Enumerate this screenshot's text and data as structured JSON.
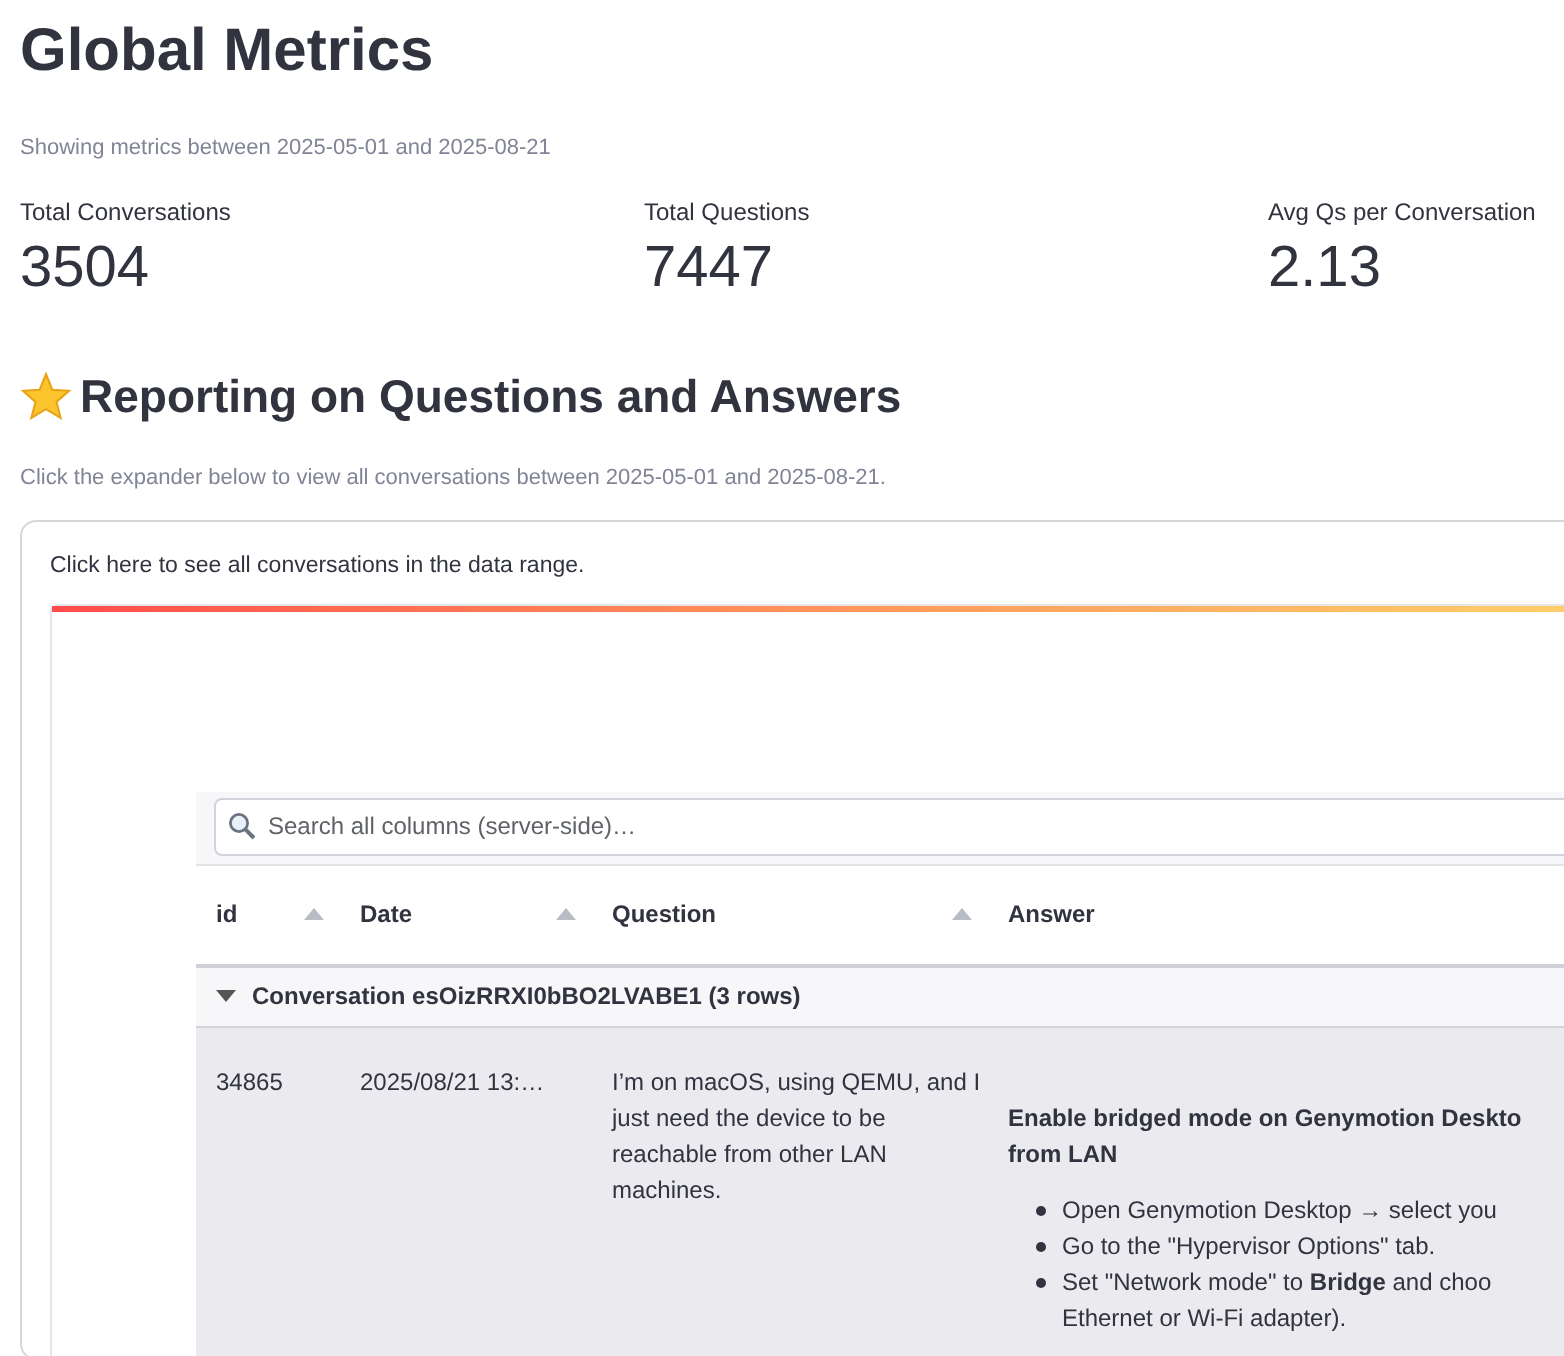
{
  "title": "Global Metrics",
  "caption": "Showing metrics between 2025-05-01 and 2025-08-21",
  "metrics": [
    {
      "label": "Total Conversations",
      "value": "3504"
    },
    {
      "label": "Total Questions",
      "value": "7447"
    },
    {
      "label": "Avg Qs per Conversation",
      "value": "2.13"
    }
  ],
  "section": {
    "title": "Reporting on Questions and Answers",
    "caption": "Click the expander below to view all conversations between 2025-05-01 and 2025-08-21."
  },
  "expander": {
    "label": "Click here to see all conversations in the data range."
  },
  "search": {
    "placeholder": "Search all columns (server-side)…"
  },
  "table": {
    "columns": [
      {
        "label": "id",
        "sortable": true
      },
      {
        "label": "Date",
        "sortable": true
      },
      {
        "label": "Question",
        "sortable": true
      },
      {
        "label": "Answer",
        "sortable": false
      }
    ],
    "groups": [
      {
        "label": "Conversation esOizRRXI0bBO2LVABE1 (3 rows)",
        "expanded": true,
        "rows": [
          {
            "id": "34865",
            "date": "2025/08/21 13:…",
            "question": "I’m on macOS, using QEMU, and I just need the device to be reachable from other LAN machines.",
            "answer": {
              "heading": [
                "Enable bridged mode on Genymotion Deskto",
                "from LAN"
              ],
              "bullets": [
                [
                  "Open Genymotion Desktop → select you"
                ],
                [
                  "Go to the \"Hypervisor Options\" tab."
                ],
                [
                  "Set \"Network mode\" to **Bridge** and choo",
                  "Ethernet or Wi-Fi adapter)."
                ]
              ]
            }
          }
        ]
      }
    ]
  }
}
